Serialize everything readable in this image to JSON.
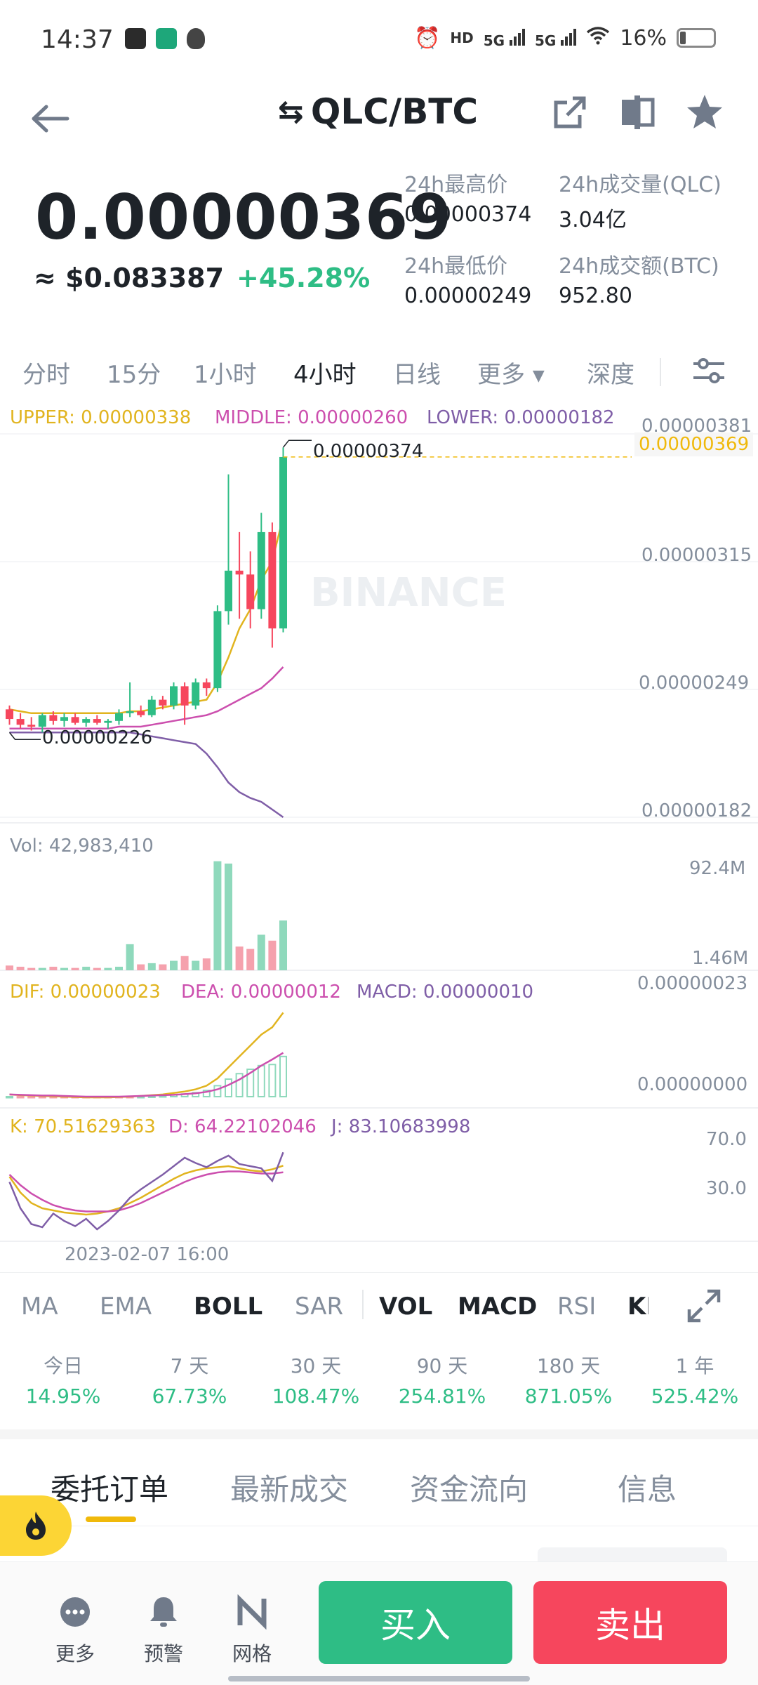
{
  "status": {
    "time": "14:37",
    "battery": "16%"
  },
  "header": {
    "pair": "QLC/BTC"
  },
  "price": {
    "last": "0.00000369",
    "usd": "≈ $0.083387",
    "change": "+45.28%"
  },
  "stats": {
    "high_label": "24h最高价",
    "high_value": "0.00000374",
    "vol_label": "24h成交量(QLC)",
    "vol_value": "3.04亿",
    "low_label": "24h最低价",
    "low_value": "0.00000249",
    "amount_label": "24h成交额(BTC)",
    "amount_value": "952.80"
  },
  "time_tabs": [
    "分时",
    "15分",
    "1小时",
    "4小时",
    "日线",
    "更多",
    "深度"
  ],
  "active_time_tab": "4小时",
  "chart": {
    "boll_upper": "UPPER: 0.00000338",
    "boll_middle": "MIDDLE: 0.00000260",
    "boll_lower": "LOWER: 0.00000182",
    "y_ticks": [
      "0.00000381",
      "0.00000315",
      "0.00000249",
      "0.00000182"
    ],
    "current_price_tag": "0.00000369",
    "max_label": "0.00000374",
    "min_label": "0.00000226",
    "watermark": "BINANCE",
    "vol_label": "Vol: 42,983,410",
    "vol_ticks": [
      "92.4M",
      "1.46M"
    ],
    "macd_dif": "DIF: 0.00000023",
    "macd_dea": "DEA: 0.00000012",
    "macd_val": "MACD: 0.00000010",
    "macd_ticks": [
      "0.00000023",
      "0.00000000"
    ],
    "kdj_k": "K: 70.51629363",
    "kdj_d": "D: 64.22102046",
    "kdj_j": "J: 83.10683998",
    "kdj_ticks": [
      "70.0",
      "30.0"
    ],
    "x_label": "2023-02-07 16:00"
  },
  "chart_data": {
    "type": "candlestick",
    "interval": "4小时",
    "ohlc": [
      [
        2.38e-06,
        2.4e-06,
        2.3e-06,
        2.33e-06
      ],
      [
        2.33e-06,
        2.36e-06,
        2.28e-06,
        2.3e-06
      ],
      [
        2.3e-06,
        2.34e-06,
        2.27e-06,
        2.29e-06
      ],
      [
        2.29e-06,
        2.36e-06,
        2.26e-06,
        2.35e-06
      ],
      [
        2.35e-06,
        2.37e-06,
        2.3e-06,
        2.32e-06
      ],
      [
        2.32e-06,
        2.36e-06,
        2.29e-06,
        2.34e-06
      ],
      [
        2.34e-06,
        2.36e-06,
        2.3e-06,
        2.31e-06
      ],
      [
        2.31e-06,
        2.34e-06,
        2.29e-06,
        2.33e-06
      ],
      [
        2.33e-06,
        2.35e-06,
        2.3e-06,
        2.31e-06
      ],
      [
        2.31e-06,
        2.33e-06,
        2.28e-06,
        2.32e-06
      ],
      [
        2.32e-06,
        2.38e-06,
        2.3e-06,
        2.36e-06
      ],
      [
        2.36e-06,
        2.52e-06,
        2.34e-06,
        2.37e-06
      ],
      [
        2.37e-06,
        2.4e-06,
        2.34e-06,
        2.35e-06
      ],
      [
        2.35e-06,
        2.45e-06,
        2.34e-06,
        2.43e-06
      ],
      [
        2.43e-06,
        2.45e-06,
        2.38e-06,
        2.4e-06
      ],
      [
        2.4e-06,
        2.52e-06,
        2.38e-06,
        2.5e-06
      ],
      [
        2.5e-06,
        2.52e-06,
        2.3e-06,
        2.4e-06
      ],
      [
        2.4e-06,
        2.54e-06,
        2.38e-06,
        2.52e-06
      ],
      [
        2.52e-06,
        2.54e-06,
        2.45e-06,
        2.49e-06
      ],
      [
        2.49e-06,
        2.92e-06,
        2.47e-06,
        2.89e-06
      ],
      [
        2.89e-06,
        3.6e-06,
        2.82e-06,
        3.1e-06
      ],
      [
        3.1e-06,
        3.3e-06,
        2.85e-06,
        3.08e-06
      ],
      [
        3.08e-06,
        3.2e-06,
        2.8e-06,
        2.9e-06
      ],
      [
        2.9e-06,
        3.4e-06,
        2.85e-06,
        3.3e-06
      ],
      [
        3.3e-06,
        3.35e-06,
        2.7e-06,
        2.8e-06
      ],
      [
        2.8e-06,
        3.74e-06,
        2.78e-06,
        3.69e-06
      ]
    ],
    "boll_upper": [
      2.38e-06,
      2.37e-06,
      2.36e-06,
      2.36e-06,
      2.36e-06,
      2.36e-06,
      2.36e-06,
      2.36e-06,
      2.36e-06,
      2.36e-06,
      2.36e-06,
      2.37e-06,
      2.37e-06,
      2.38e-06,
      2.39e-06,
      2.4e-06,
      2.41e-06,
      2.42e-06,
      2.43e-06,
      2.52e-06,
      2.65e-06,
      2.8e-06,
      2.9e-06,
      3.05e-06,
      3.15e-06,
      3.38e-06
    ],
    "boll_middle": [
      2.28e-06,
      2.28e-06,
      2.28e-06,
      2.28e-06,
      2.28e-06,
      2.28e-06,
      2.28e-06,
      2.28e-06,
      2.28e-06,
      2.28e-06,
      2.29e-06,
      2.29e-06,
      2.29e-06,
      2.3e-06,
      2.31e-06,
      2.32e-06,
      2.33e-06,
      2.34e-06,
      2.35e-06,
      2.37e-06,
      2.4e-06,
      2.43e-06,
      2.46e-06,
      2.49e-06,
      2.54e-06,
      2.6e-06
    ],
    "boll_lower": [
      2.26e-06,
      2.26e-06,
      2.26e-06,
      2.26e-06,
      2.26e-06,
      2.26e-06,
      2.26e-06,
      2.26e-06,
      2.26e-06,
      2.26e-06,
      2.26e-06,
      2.26e-06,
      2.25e-06,
      2.24e-06,
      2.23e-06,
      2.22e-06,
      2.21e-06,
      2.2e-06,
      2.15e-06,
      2.08e-06,
      2e-06,
      1.95e-06,
      1.92e-06,
      1.9e-06,
      1.86e-06,
      1.82e-06
    ],
    "volume_m": [
      4,
      3,
      2,
      2,
      3,
      2,
      2,
      3,
      2,
      2,
      3,
      22,
      5,
      6,
      5,
      8,
      12,
      8,
      10,
      92,
      90,
      20,
      18,
      30,
      25,
      42
    ],
    "macd_dif": [
      0.6,
      0.4,
      0.3,
      0.2,
      0.1,
      0.0,
      -0.1,
      -0.2,
      -0.2,
      -0.2,
      -0.1,
      0.0,
      0.2,
      0.4,
      0.6,
      1.0,
      1.4,
      2.0,
      3.0,
      5.0,
      8.0,
      11.0,
      14.0,
      17.0,
      19.0,
      23.0
    ],
    "macd_dea": [
      0.6,
      0.5,
      0.4,
      0.3,
      0.3,
      0.2,
      0.1,
      0.0,
      0.0,
      0.0,
      0.0,
      0.1,
      0.2,
      0.3,
      0.4,
      0.5,
      0.7,
      0.9,
      1.3,
      2.0,
      3.2,
      4.7,
      6.5,
      8.5,
      10.2,
      12.0
    ],
    "macd_hist": [
      0,
      -0.1,
      -0.1,
      -0.1,
      -0.2,
      -0.2,
      -0.2,
      -0.2,
      -0.2,
      -0.2,
      -0.1,
      -0.1,
      0.0,
      0.1,
      0.2,
      0.5,
      0.7,
      1.1,
      1.7,
      3.0,
      4.8,
      6.3,
      7.5,
      8.5,
      8.8,
      11.0
    ],
    "kdj_k": [
      60,
      45,
      35,
      30,
      28,
      26,
      25,
      24,
      25,
      27,
      30,
      35,
      40,
      46,
      52,
      58,
      63,
      66,
      68,
      69,
      70,
      68,
      66,
      65,
      67,
      70.5
    ],
    "kdj_d": [
      62,
      52,
      44,
      38,
      33,
      30,
      28,
      27,
      27,
      27,
      28,
      31,
      35,
      40,
      45,
      50,
      55,
      59,
      62,
      64,
      65,
      65,
      64,
      63,
      63,
      64.2
    ],
    "kdj_j": [
      55,
      30,
      15,
      12,
      25,
      18,
      13,
      20,
      10,
      18,
      28,
      40,
      48,
      55,
      62,
      70,
      78,
      73,
      69,
      75,
      80,
      72,
      70,
      68,
      56,
      83.1
    ],
    "y_range": [
      1.82e-06,
      3.81e-06
    ],
    "highlight": {
      "high": "0.00000374",
      "low": "0.00000226",
      "last": "0.00000369"
    }
  },
  "indicator_tabs": [
    "MA",
    "EMA",
    "BOLL",
    "SAR",
    "VOL",
    "MACD",
    "RSI",
    "KI"
  ],
  "performance": [
    {
      "label": "今日",
      "value": "14.95%"
    },
    {
      "label": "7 天",
      "value": "67.73%"
    },
    {
      "label": "30 天",
      "value": "108.47%"
    },
    {
      "label": "90 天",
      "value": "254.81%"
    },
    {
      "label": "180 天",
      "value": "871.05%"
    },
    {
      "label": "1 年",
      "value": "525.42%"
    }
  ],
  "bottom_tabs": [
    "委托订单",
    "最新成交",
    "资金流向",
    "信息"
  ],
  "actions": {
    "more": "更多",
    "alert": "预警",
    "grid": "网格",
    "buy": "买入",
    "sell": "卖出"
  },
  "colors": {
    "up": "#2ebd85",
    "down": "#f6465d",
    "upper": "#e1b41f",
    "middle": "#cc4fae",
    "lower": "#7f5ea7",
    "accent": "#f0b90b"
  }
}
